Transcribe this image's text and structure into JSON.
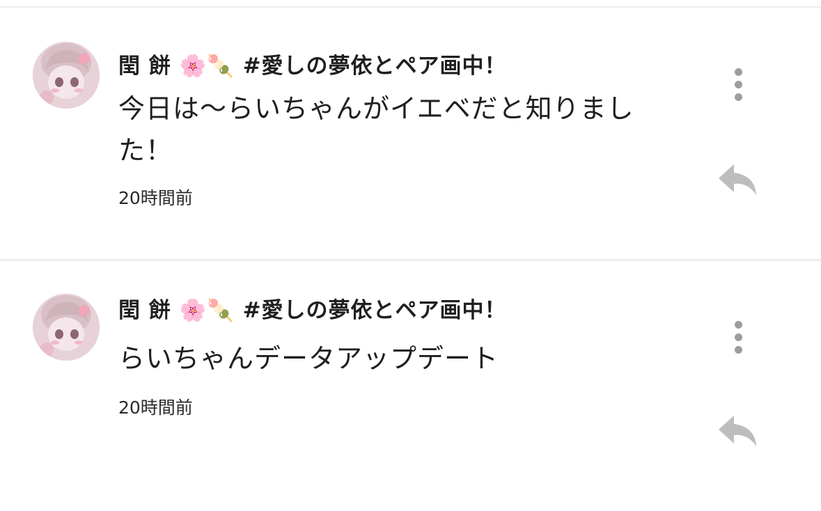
{
  "comments": [
    {
      "author": "閏 餅 🌸🍡 #愛しの夢依とペア画中！",
      "text": "今日は〜らいちゃんがイエベだと知りました！",
      "time": "20時間前"
    },
    {
      "author": "閏 餅 🌸🍡 #愛しの夢依とペア画中！",
      "text": "らいちゃんデータアップデート",
      "time": "20時間前"
    }
  ],
  "icons": {
    "more": "more-vertical-icon",
    "reply": "reply-icon"
  },
  "colors": {
    "icon": "#9d9d9d",
    "divider": "#ececec",
    "text": "#1f1f1f"
  }
}
